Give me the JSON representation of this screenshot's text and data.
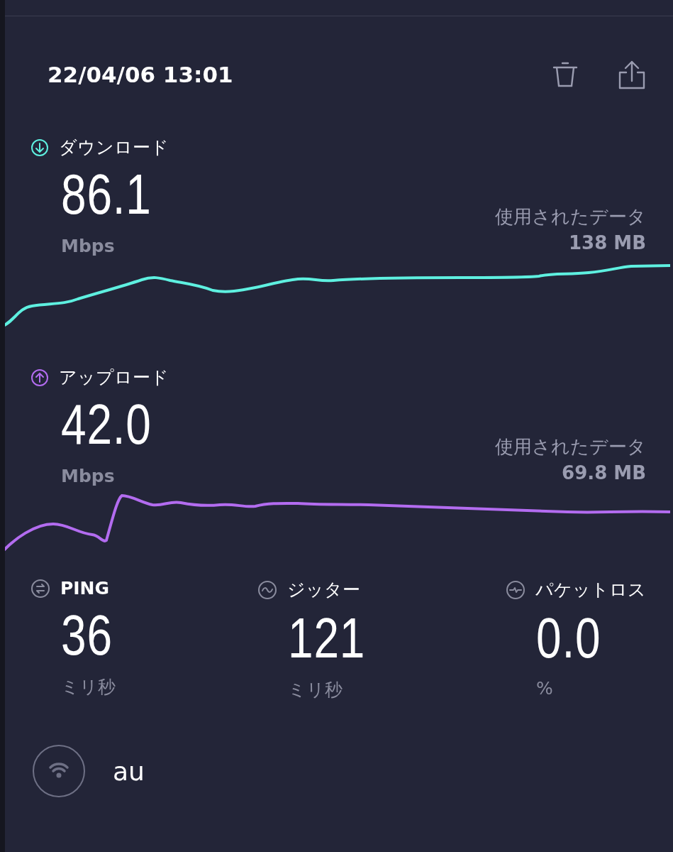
{
  "header": {
    "timestamp": "22/04/06 13:01"
  },
  "speeds": [
    {
      "kind": "download",
      "label": "ダウンロード",
      "value": "86.1",
      "unit": "Mbps",
      "data_label": "使用されたデータ",
      "data_value": "138 MB",
      "color": "#5ef0e0"
    },
    {
      "kind": "upload",
      "label": "アップロード",
      "value": "42.0",
      "unit": "Mbps",
      "data_label": "使用されたデータ",
      "data_value": "69.8 MB",
      "color": "#b36cf0"
    }
  ],
  "metrics": [
    {
      "kind": "ping",
      "label": "PING",
      "value": "36",
      "unit": "ミリ秒"
    },
    {
      "kind": "jitter",
      "label": "ジッター",
      "value": "121",
      "unit": "ミリ秒"
    },
    {
      "kind": "loss",
      "label": "パケットロス",
      "value": "0.0",
      "unit": "%"
    }
  ],
  "provider": {
    "name": "au"
  }
}
